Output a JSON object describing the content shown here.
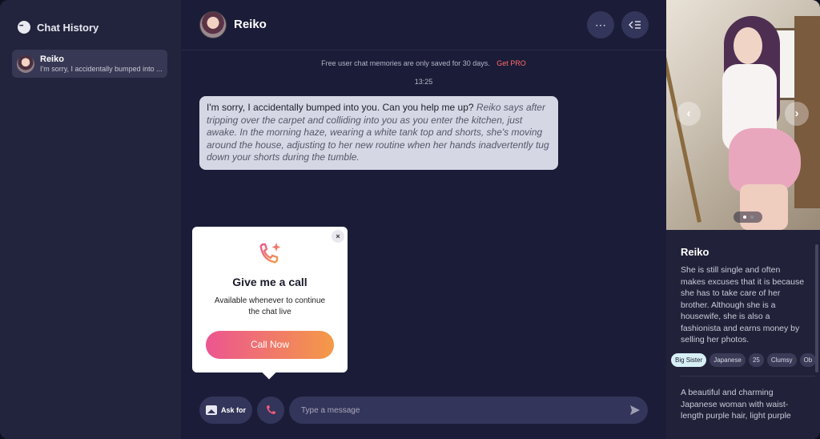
{
  "sidebar": {
    "title": "Chat History",
    "chats": [
      {
        "name": "Reiko",
        "preview": "I'm sorry, I accidentally bumped into ..."
      }
    ]
  },
  "header": {
    "name": "Reiko",
    "more_icon": "more-horizontal-icon",
    "collapse_icon": "collapse-panel-icon"
  },
  "notice": {
    "text": "Free user chat memories are only saved for 30 days.",
    "link": "Get PRO"
  },
  "timestamp": "13:25",
  "message": {
    "speech": "I'm sorry, I accidentally bumped into you. Can you help me up?",
    "action": "Reiko says after tripping over the carpet and colliding into you as you enter the kitchen, just awake. In the morning haze, wearing a white tank top and shorts, she's moving around the house, adjusting to her new routine when her hands inadvertently tug down your shorts during the tumble."
  },
  "popup": {
    "close": "×",
    "icon": "phone-sparkle-icon",
    "title": "Give me a call",
    "description": "Available whenever to continue the chat live",
    "button": "Call Now"
  },
  "input": {
    "ask_label": "Ask for",
    "placeholder": "Type a message"
  },
  "profile": {
    "name": "Reiko",
    "description": "She is still single and often makes excuses that it is because she has to take care of her brother. Although she is a housewife, she is also a fashionista and earns money by selling her photos.",
    "tags": [
      "Big Sister",
      "Japanese",
      "25",
      "Clumsy",
      "Ob"
    ],
    "description2": "A beautiful and charming Japanese woman with waist-length purple hair, light purple",
    "carousel_dots": 2,
    "carousel_active": 0
  },
  "colors": {
    "accent_gradient_start": "#ec5590",
    "accent_gradient_end": "#f49a47",
    "pro_link": "#ff6b6b",
    "tag_highlight": "#d7f0f7"
  }
}
